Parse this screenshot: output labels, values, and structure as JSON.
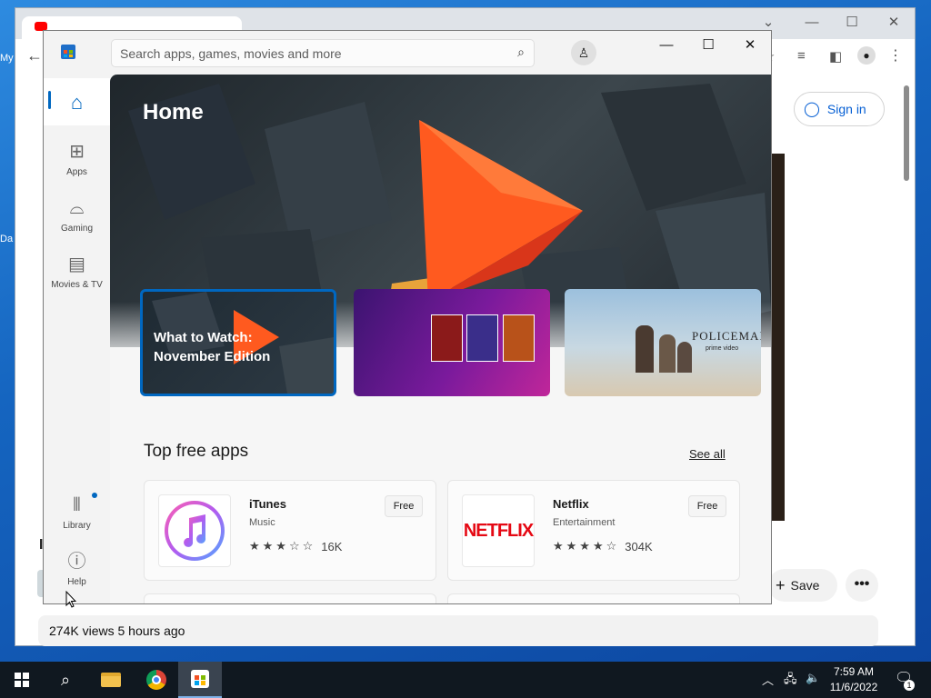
{
  "desktop": {
    "icons": [
      {
        "label": "My",
        "id": "desktop-icon-my"
      },
      {
        "label": "Da",
        "id": "desktop-icon-da"
      }
    ]
  },
  "chrome": {
    "tab_title": "",
    "signin_label": "Sign in",
    "views_text": "274K views  5 hours ago",
    "save_label": "Save",
    "more_label": "•••"
  },
  "store": {
    "search_placeholder": "Search apps, games, movies and more",
    "nav": [
      {
        "label": "",
        "icon": "home-icon"
      },
      {
        "label": "Apps",
        "icon": "apps-icon"
      },
      {
        "label": "Gaming",
        "icon": "gamepad-icon"
      },
      {
        "label": "Movies & TV",
        "icon": "clapperboard-icon"
      },
      {
        "label": "Library",
        "icon": "library-icon"
      },
      {
        "label": "Help",
        "icon": "help-icon"
      }
    ],
    "hero_title": "Home",
    "cards": [
      {
        "title_line1": "What to Watch:",
        "title_line2": "November Edition"
      },
      {
        "title": ""
      },
      {
        "title": "POLICEMAN",
        "subtitle": "prime video"
      }
    ],
    "section_title": "Top free apps",
    "see_all": "See all",
    "apps": [
      {
        "name": "iTunes",
        "category": "Music",
        "price": "Free",
        "rating_count": "16K",
        "stars": 3,
        "icon": "itunes-icon"
      },
      {
        "name": "Netflix",
        "category": "Entertainment",
        "price": "Free",
        "rating_count": "304K",
        "stars": 4,
        "icon": "netflix-icon",
        "logo_text": "NETFLIX"
      }
    ]
  },
  "taskbar": {
    "time": "7:59 AM",
    "date": "11/6/2022",
    "notification_count": "1"
  },
  "colors": {
    "accent": "#0067c0",
    "netflix_red": "#e50914",
    "yt_blue": "#065fd4"
  }
}
